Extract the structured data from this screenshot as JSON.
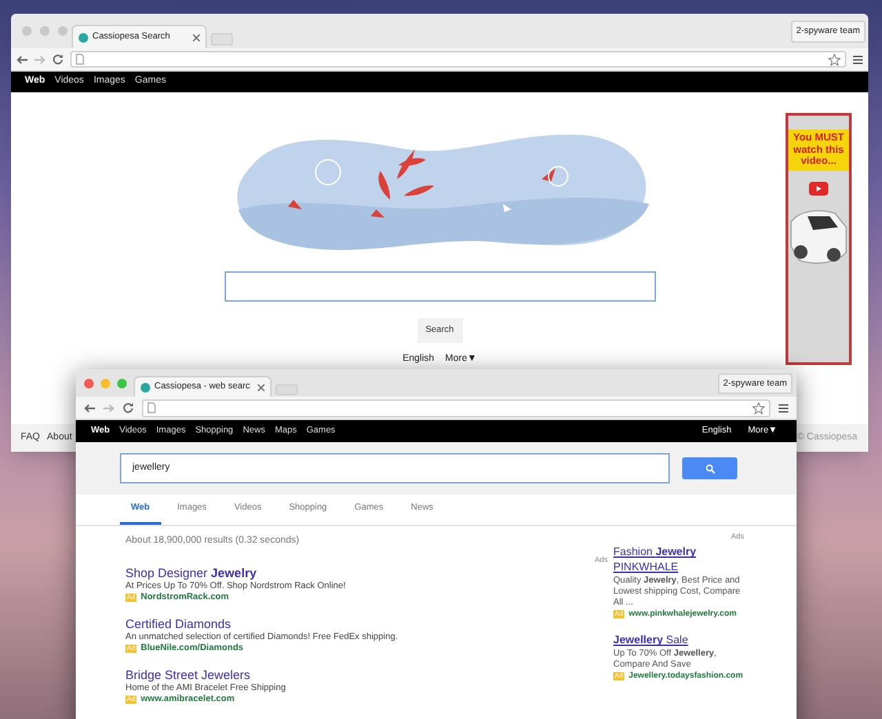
{
  "back_window": {
    "tab": {
      "title": "Cassiopesa Search"
    },
    "profile": "2-spyware team",
    "nav": [
      {
        "label": "Web",
        "selected": true
      },
      {
        "label": "Videos",
        "selected": false
      },
      {
        "label": "Images",
        "selected": false
      },
      {
        "label": "Games",
        "selected": false
      }
    ],
    "search_button": "Search",
    "language": "English",
    "more": "More▼",
    "ad_banner": {
      "text": "You MUST watch this video..."
    },
    "footer": {
      "links": [
        "FAQ",
        "About"
      ],
      "copyright": "© Cassiopesa"
    }
  },
  "front_window": {
    "tab": {
      "title": "Cassiopesa - web searc"
    },
    "profile": "2-spyware team",
    "nav": [
      {
        "label": "Web",
        "selected": true
      },
      {
        "label": "Videos",
        "selected": false
      },
      {
        "label": "Images",
        "selected": false
      },
      {
        "label": "Shopping",
        "selected": false
      },
      {
        "label": "News",
        "selected": false
      },
      {
        "label": "Maps",
        "selected": false
      },
      {
        "label": "Games",
        "selected": false
      }
    ],
    "language": "English",
    "more": "More▼",
    "search": {
      "value": "jewellery"
    },
    "tabs": [
      {
        "label": "Web",
        "selected": true
      },
      {
        "label": "Images",
        "selected": false
      },
      {
        "label": "Videos",
        "selected": false
      },
      {
        "label": "Shopping",
        "selected": false
      },
      {
        "label": "Games",
        "selected": false
      },
      {
        "label": "News",
        "selected": false
      }
    ],
    "stats": "About 18,900,000 results (0.32 seconds)",
    "ads_label": "Ads",
    "results": [
      {
        "title": "Shop Designer **Jewelry**",
        "description": "At Prices Up To 70% Off. Shop Nordstrom Rack Online!",
        "badge": "Ad",
        "url": "NordstromRack.com"
      },
      {
        "title": "Certified Diamonds",
        "description": "An unmatched selection of certified Diamonds! Free FedEx shipping.",
        "badge": "Ad",
        "url": "BlueNile.com/Diamonds"
      },
      {
        "title": "Bridge Street Jewelers",
        "description": "Home of the AMI Bracelet Free Shipping",
        "badge": "Ad",
        "url": "www.amibracelet.com"
      }
    ],
    "side_ads_label": "Ads",
    "side_ads": [
      {
        "title": "Fashion **Jewelry** PINKWHALE",
        "description": "Quality **Jewelry**, Best Price and Lowest shipping Cost, Compare All ...",
        "badge": "Ad",
        "url": "www.pinkwhalejewelry.com"
      },
      {
        "title": "**Jewellery** Sale",
        "description": "Up To 70% Off **Jewellery**, Compare And Save",
        "badge": "Ad",
        "url": "Jewellery.todaysfashion.com"
      }
    ]
  }
}
